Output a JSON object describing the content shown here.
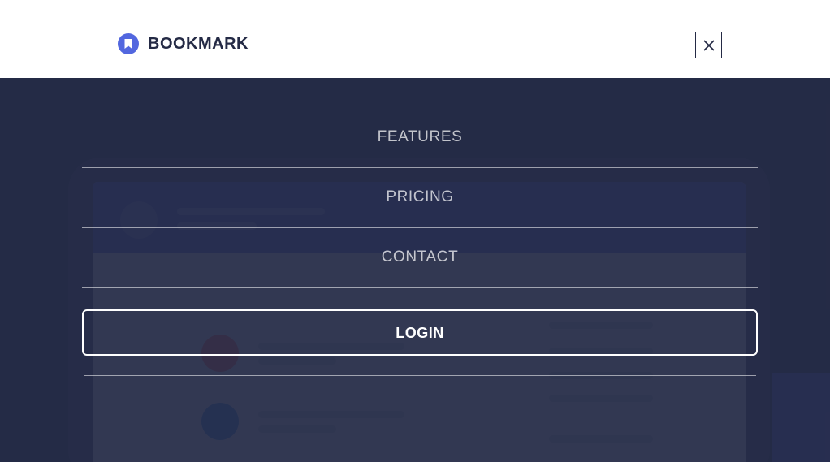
{
  "brand": {
    "name": "BOOKMARK",
    "logo_icon": "bookmark-icon"
  },
  "header": {
    "close_icon": "close-icon"
  },
  "menu": {
    "items": [
      {
        "label": "FEATURES"
      },
      {
        "label": "PRICING"
      },
      {
        "label": "CONTACT"
      }
    ],
    "login_label": "LOGIN"
  },
  "colors": {
    "accent": "#5267df",
    "dark_navy": "#242a45",
    "overlay": "#252b46",
    "accent_red": "#fa5757"
  }
}
